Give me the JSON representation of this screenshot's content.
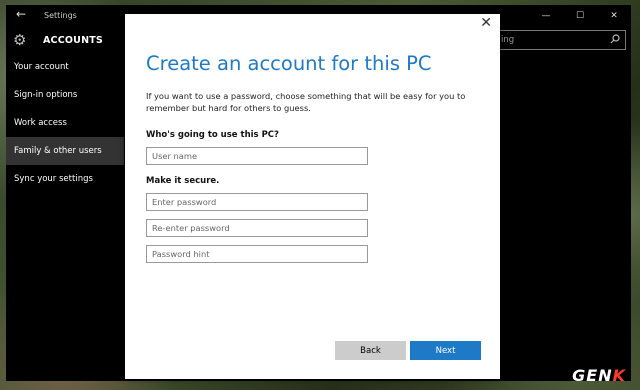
{
  "window": {
    "title": "Settings",
    "back_glyph": "←",
    "controls": [
      "—",
      "☐",
      "✕"
    ]
  },
  "header": {
    "section_title": "ACCOUNTS",
    "search_text": "ing",
    "icons": [
      "gear-icon",
      "search-icon"
    ]
  },
  "sidebar": {
    "items": [
      {
        "label": "Your account"
      },
      {
        "label": "Sign-in options"
      },
      {
        "label": "Work access"
      },
      {
        "label": "Family & other users",
        "active": true
      },
      {
        "label": "Sync your settings"
      }
    ]
  },
  "dialog": {
    "title": "Create an account for this PC",
    "description": "If you want to use a password, choose something that will be easy for you to remember but hard for others to guess.",
    "who_label": "Who's going to use this PC?",
    "username_placeholder": "User name",
    "secure_label": "Make it secure.",
    "password_placeholder": "Enter password",
    "reenter_placeholder": "Re-enter password",
    "hint_placeholder": "Password hint",
    "back_label": "Back",
    "next_label": "Next",
    "close_glyph": "✕"
  },
  "watermark": {
    "prefix": "GEN",
    "accent": "K"
  },
  "colors": {
    "accent": "#1e7ac7",
    "window_bg": "#000000",
    "dialog_bg": "#ffffff",
    "back_button": "#cccccc",
    "watermark_accent": "#ff3a2b"
  }
}
